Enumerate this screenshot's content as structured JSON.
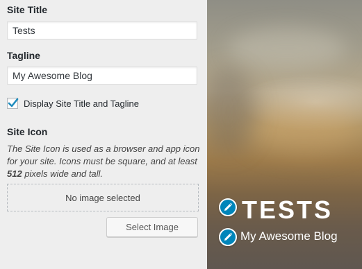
{
  "site_identity": {
    "site_title_label": "Site Title",
    "site_title_value": "Tests",
    "tagline_label": "Tagline",
    "tagline_value": "My Awesome Blog",
    "display_checkbox_label": "Display Site Title and Tagline",
    "display_checkbox_checked": true,
    "site_icon_label": "Site Icon",
    "site_icon_desc_1": "The Site Icon is used as a browser and app icon for your site. Icons must be square, and at least ",
    "site_icon_desc_bold": "512",
    "site_icon_desc_2": " pixels wide and tall.",
    "no_image_text": "No image selected",
    "select_image_label": "Select Image"
  },
  "preview": {
    "title": "TESTS",
    "tagline": "My Awesome Blog",
    "edit_icon": "pencil-icon",
    "accent": "#0085ba"
  }
}
